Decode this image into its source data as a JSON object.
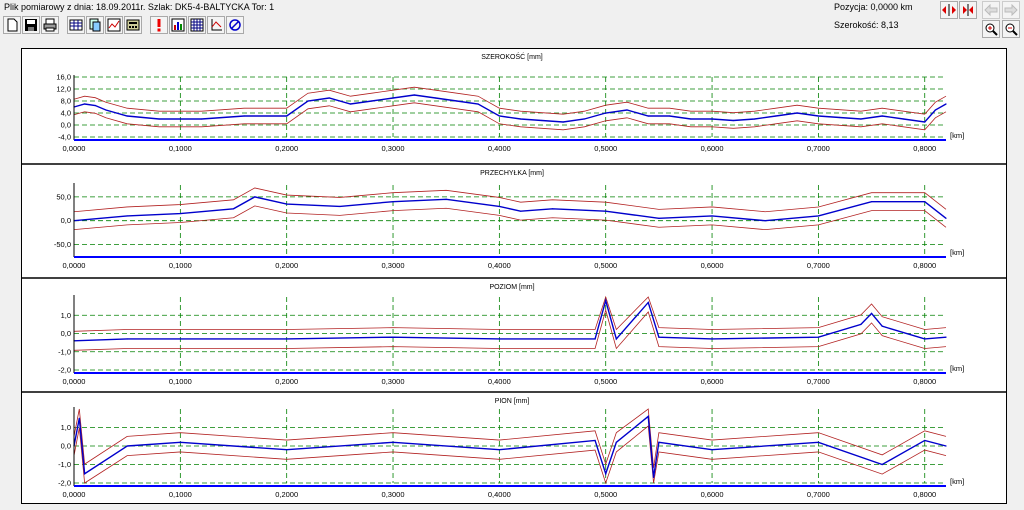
{
  "header": {
    "file_info": "Plik pomiarowy z dnia: 18.09.2011r. Szlak: DK5-4-BALTYCKA Tor: 1",
    "position": "Pozycja: 0,0000 km",
    "width_readout": "Szerokość: 8,13"
  },
  "toolbar": {
    "buttons": [
      "new-file-icon",
      "save-icon",
      "print-icon",
      "table-icon",
      "copy-icon",
      "chart-icon",
      "calculator-icon",
      "alert-icon",
      "bar-chart-icon",
      "grid-icon",
      "axis-icon",
      "no-icon"
    ]
  },
  "x_axis": {
    "unit": "[km]",
    "ticks": [
      "0,0000",
      "0,1000",
      "0,2000",
      "0,3000",
      "0,4000",
      "0,5000",
      "0,6000",
      "0,7000",
      "0,8000"
    ]
  },
  "colors": {
    "trace": "#0000cc",
    "limit": "#b22222",
    "grid": "#008000",
    "baseline": "#0000ff"
  },
  "chart_data": [
    {
      "type": "line",
      "title": "SZEROKOŚĆ [mm]",
      "ylim": [
        -4.0,
        16.0
      ],
      "yticks": [
        "16,0",
        "12,0",
        "8,0",
        "4,0",
        "0,0",
        "-4,0"
      ],
      "ytick_values": [
        16,
        12,
        8,
        4,
        0,
        -4
      ],
      "xlim": [
        0,
        0.82
      ],
      "x": [
        0,
        0.01,
        0.02,
        0.03,
        0.05,
        0.08,
        0.12,
        0.16,
        0.2,
        0.22,
        0.24,
        0.26,
        0.28,
        0.3,
        0.32,
        0.34,
        0.36,
        0.38,
        0.4,
        0.42,
        0.44,
        0.46,
        0.48,
        0.5,
        0.52,
        0.54,
        0.56,
        0.58,
        0.6,
        0.62,
        0.64,
        0.66,
        0.68,
        0.7,
        0.72,
        0.74,
        0.76,
        0.78,
        0.8,
        0.81,
        0.82
      ],
      "y": [
        6,
        7,
        6.5,
        5,
        3,
        2,
        2,
        3,
        3,
        8,
        9,
        7,
        8,
        9,
        10,
        9,
        8,
        7,
        3,
        2,
        1.5,
        1,
        2,
        4,
        5,
        3,
        3,
        2,
        2,
        1.5,
        2,
        3,
        4,
        3,
        2.5,
        2,
        3,
        2,
        1,
        5,
        7
      ]
    },
    {
      "type": "line",
      "title": "PRZECHYŁKA [mm]",
      "ylim": [
        -70,
        75
      ],
      "yticks": [
        "50,0",
        "0,0",
        "-50,0"
      ],
      "ytick_values": [
        50,
        0,
        -50
      ],
      "xlim": [
        0,
        0.82
      ],
      "x": [
        0,
        0.05,
        0.1,
        0.15,
        0.17,
        0.2,
        0.25,
        0.3,
        0.35,
        0.4,
        0.42,
        0.45,
        0.5,
        0.55,
        0.6,
        0.65,
        0.7,
        0.75,
        0.8,
        0.82
      ],
      "y": [
        0,
        10,
        15,
        25,
        50,
        35,
        30,
        40,
        45,
        30,
        20,
        25,
        20,
        5,
        10,
        0,
        10,
        40,
        40,
        5
      ]
    },
    {
      "type": "line",
      "title": "POZIOM [mm]",
      "ylim": [
        -2.0,
        2.0
      ],
      "yticks": [
        "1,0",
        "0,0",
        "-1,0",
        "-2,0"
      ],
      "ytick_values": [
        1,
        0,
        -1,
        -2
      ],
      "xlim": [
        0,
        0.82
      ],
      "x": [
        0,
        0.05,
        0.1,
        0.2,
        0.3,
        0.4,
        0.49,
        0.5,
        0.51,
        0.54,
        0.55,
        0.6,
        0.7,
        0.74,
        0.75,
        0.76,
        0.8,
        0.82
      ],
      "y": [
        -0.4,
        -0.3,
        -0.3,
        -0.3,
        -0.2,
        -0.3,
        -0.3,
        1.8,
        -0.3,
        1.7,
        -0.2,
        -0.3,
        -0.2,
        0.5,
        1.1,
        0.4,
        -0.3,
        -0.2
      ]
    },
    {
      "type": "line",
      "title": "PION [mm]",
      "ylim": [
        -2.0,
        2.0
      ],
      "yticks": [
        "1,0",
        "0,0",
        "-1,0",
        "-2,0"
      ],
      "ytick_values": [
        1,
        0,
        -1,
        -2
      ],
      "xlim": [
        0,
        0.82
      ],
      "x": [
        0,
        0.005,
        0.01,
        0.05,
        0.1,
        0.2,
        0.3,
        0.4,
        0.49,
        0.5,
        0.51,
        0.54,
        0.545,
        0.55,
        0.6,
        0.7,
        0.76,
        0.8,
        0.82
      ],
      "y": [
        0,
        1.5,
        -1.5,
        0,
        0.2,
        -0.2,
        0.2,
        -0.2,
        0.3,
        -1.5,
        0.2,
        1.6,
        -1.7,
        0.2,
        -0.2,
        0.2,
        -1.0,
        0.3,
        0
      ]
    }
  ]
}
